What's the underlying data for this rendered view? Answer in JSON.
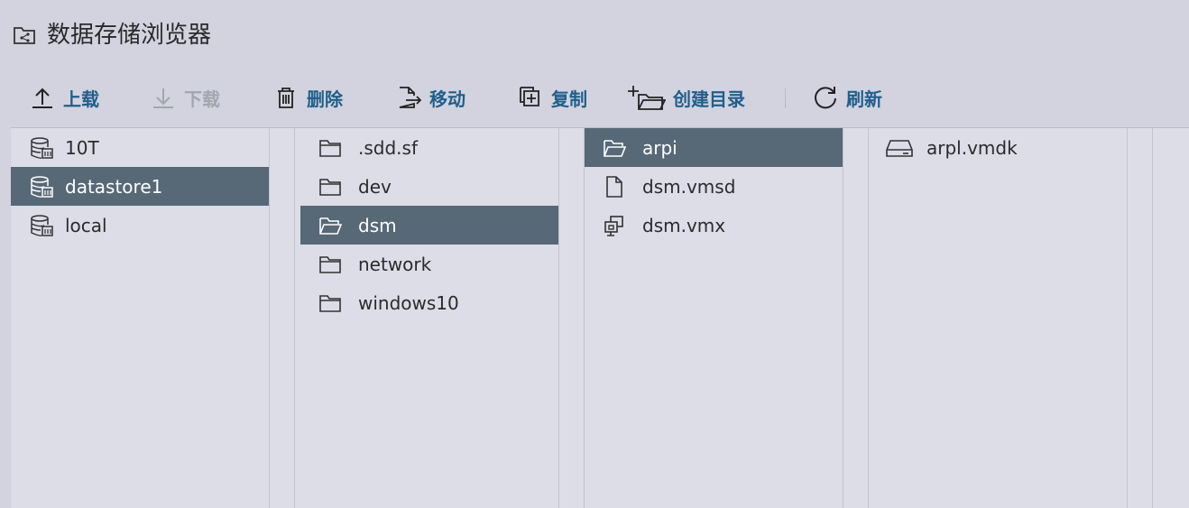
{
  "window": {
    "title": "数据存储浏览器",
    "title_icon": "folder-share-icon"
  },
  "toolbar": {
    "upload": {
      "label": "上载",
      "icon": "upload-arrow-icon"
    },
    "download": {
      "label": "下载",
      "icon": "download-arrow-icon",
      "disabled": true
    },
    "delete": {
      "label": "删除",
      "icon": "trash-icon"
    },
    "move": {
      "label": "移动",
      "icon": "file-move-icon"
    },
    "copy": {
      "label": "复制",
      "icon": "copy-icon"
    },
    "mkdir": {
      "label": "创建目录",
      "icon": "folder-plus-icon"
    },
    "refresh": {
      "label": "刷新",
      "icon": "refresh-icon"
    }
  },
  "columns": [
    {
      "items": [
        {
          "label": "10T",
          "icon": "datastore-icon",
          "selected": false
        },
        {
          "label": "datastore1",
          "icon": "datastore-icon",
          "selected": true
        },
        {
          "label": "local",
          "icon": "datastore-icon",
          "selected": false
        }
      ]
    },
    {
      "items": [
        {
          "label": ".sdd.sf",
          "icon": "folder-icon",
          "selected": false
        },
        {
          "label": "dev",
          "icon": "folder-icon",
          "selected": false
        },
        {
          "label": "dsm",
          "icon": "folder-open-icon",
          "selected": true
        },
        {
          "label": "network",
          "icon": "folder-icon",
          "selected": false
        },
        {
          "label": "windows10",
          "icon": "folder-icon",
          "selected": false
        }
      ]
    },
    {
      "items": [
        {
          "label": "arpi",
          "icon": "folder-open-icon",
          "selected": true
        },
        {
          "label": "dsm.vmsd",
          "icon": "file-icon",
          "selected": false
        },
        {
          "label": "dsm.vmx",
          "icon": "vm-icon",
          "selected": false
        }
      ]
    },
    {
      "items": [
        {
          "label": "arpl.vmdk",
          "icon": "disk-icon",
          "selected": false
        }
      ]
    }
  ],
  "colors": {
    "accent": "#1f5f8b",
    "selected_row": "#576877",
    "disabled": "#a3a6ad"
  }
}
